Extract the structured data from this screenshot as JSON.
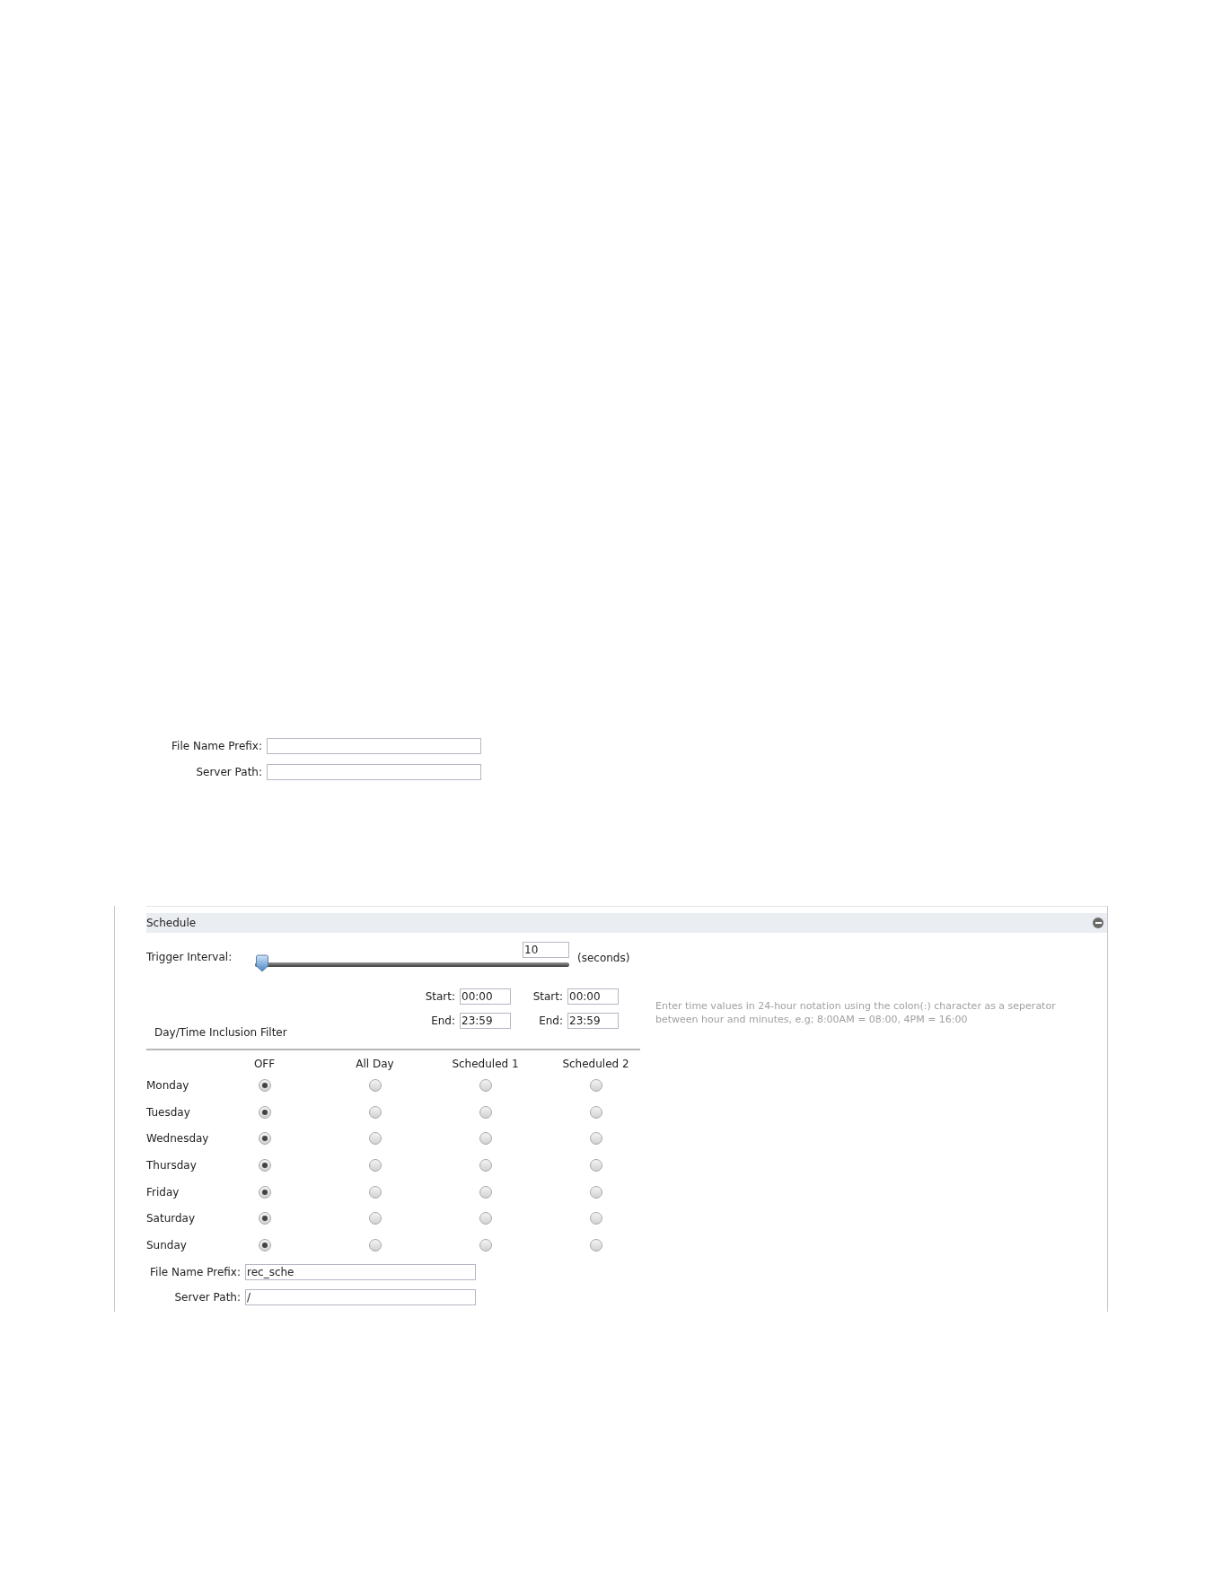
{
  "top_form": {
    "fields": [
      {
        "label": "File Name Prefix:"
      },
      {
        "label": "Server Path:"
      }
    ]
  },
  "schedule": {
    "title": "Schedule",
    "expanded": true,
    "trigger_interval": {
      "label": "Trigger Interval:",
      "level": 0,
      "value": "10",
      "unit": "(seconds)"
    },
    "filter_label": "Day/Time Inclusion Filter",
    "time_slots": [
      {
        "start_label": "Start:",
        "start_value": "00:00",
        "end_label": "End:",
        "end_value": "23:59"
      },
      {
        "start_label": "Start:",
        "start_value": "00:00",
        "end_label": "End:",
        "end_value": "23:59"
      }
    ],
    "note": "Enter time values in 24-hour notation using the colon(:) character as a seperator between hour and minutes, e.g; 8:00AM = 08:00, 4PM = 16:00",
    "columns": [
      "OFF",
      "All Day",
      "Scheduled 1",
      "Scheduled 2"
    ],
    "rows": [
      {
        "day": "Monday",
        "options": [
          {
            "selected": true
          },
          {
            "selected": false
          },
          {
            "selected": false
          },
          {
            "selected": false
          }
        ]
      },
      {
        "day": "Tuesday",
        "options": [
          {
            "selected": true
          },
          {
            "selected": false
          },
          {
            "selected": false
          },
          {
            "selected": false
          }
        ]
      },
      {
        "day": "Wednesday",
        "options": [
          {
            "selected": true
          },
          {
            "selected": false
          },
          {
            "selected": false
          },
          {
            "selected": false
          }
        ]
      },
      {
        "day": "Thursday",
        "options": [
          {
            "selected": true
          },
          {
            "selected": false
          },
          {
            "selected": false
          },
          {
            "selected": false
          }
        ]
      },
      {
        "day": "Friday",
        "options": [
          {
            "selected": true
          },
          {
            "selected": false
          },
          {
            "selected": false
          },
          {
            "selected": false
          }
        ]
      },
      {
        "day": "Saturday",
        "options": [
          {
            "selected": true
          },
          {
            "selected": false
          },
          {
            "selected": false
          },
          {
            "selected": false
          }
        ]
      },
      {
        "day": "Sunday",
        "options": [
          {
            "selected": true
          },
          {
            "selected": false
          },
          {
            "selected": false
          },
          {
            "selected": false
          }
        ]
      }
    ],
    "fields": [
      {
        "label": "File Name Prefix:",
        "value": "rec_sche"
      },
      {
        "label": "Server Path:",
        "value": "/"
      }
    ]
  }
}
